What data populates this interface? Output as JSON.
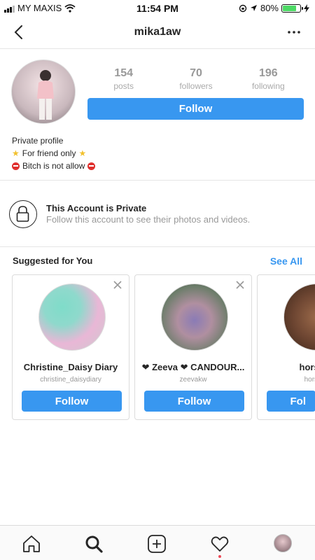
{
  "status_bar": {
    "carrier": "MY MAXIS",
    "time": "11:54 PM",
    "battery": "80%",
    "battery_level": 0.8
  },
  "nav": {
    "title": "mika1aw",
    "back_icon": "chevron-left-icon",
    "more_icon": "more-horizontal-icon"
  },
  "profile": {
    "stats": [
      {
        "value": "154",
        "label": "posts"
      },
      {
        "value": "70",
        "label": "followers"
      },
      {
        "value": "196",
        "label": "following"
      }
    ],
    "follow_label": "Follow",
    "bio": {
      "line1": "Private profile",
      "line2": "For friend only",
      "line3": "Bitch is not allow"
    }
  },
  "private_notice": {
    "title": "This Account is Private",
    "subtitle": "Follow this account to see their photos and videos."
  },
  "suggested": {
    "title": "Suggested for You",
    "see_all": "See All",
    "cards": [
      {
        "name": "Christine_Daisy Diary",
        "handle": "christine_daisydiary",
        "button": "Follow"
      },
      {
        "name": "❤ Zeeva ❤ CANDOUR...",
        "handle": "zeevakw",
        "button": "Follow"
      },
      {
        "name": "horsegi",
        "handle": "horsegi",
        "button": "Fol"
      }
    ]
  },
  "colors": {
    "accent": "#3897f0",
    "notification": "#ed4956"
  }
}
